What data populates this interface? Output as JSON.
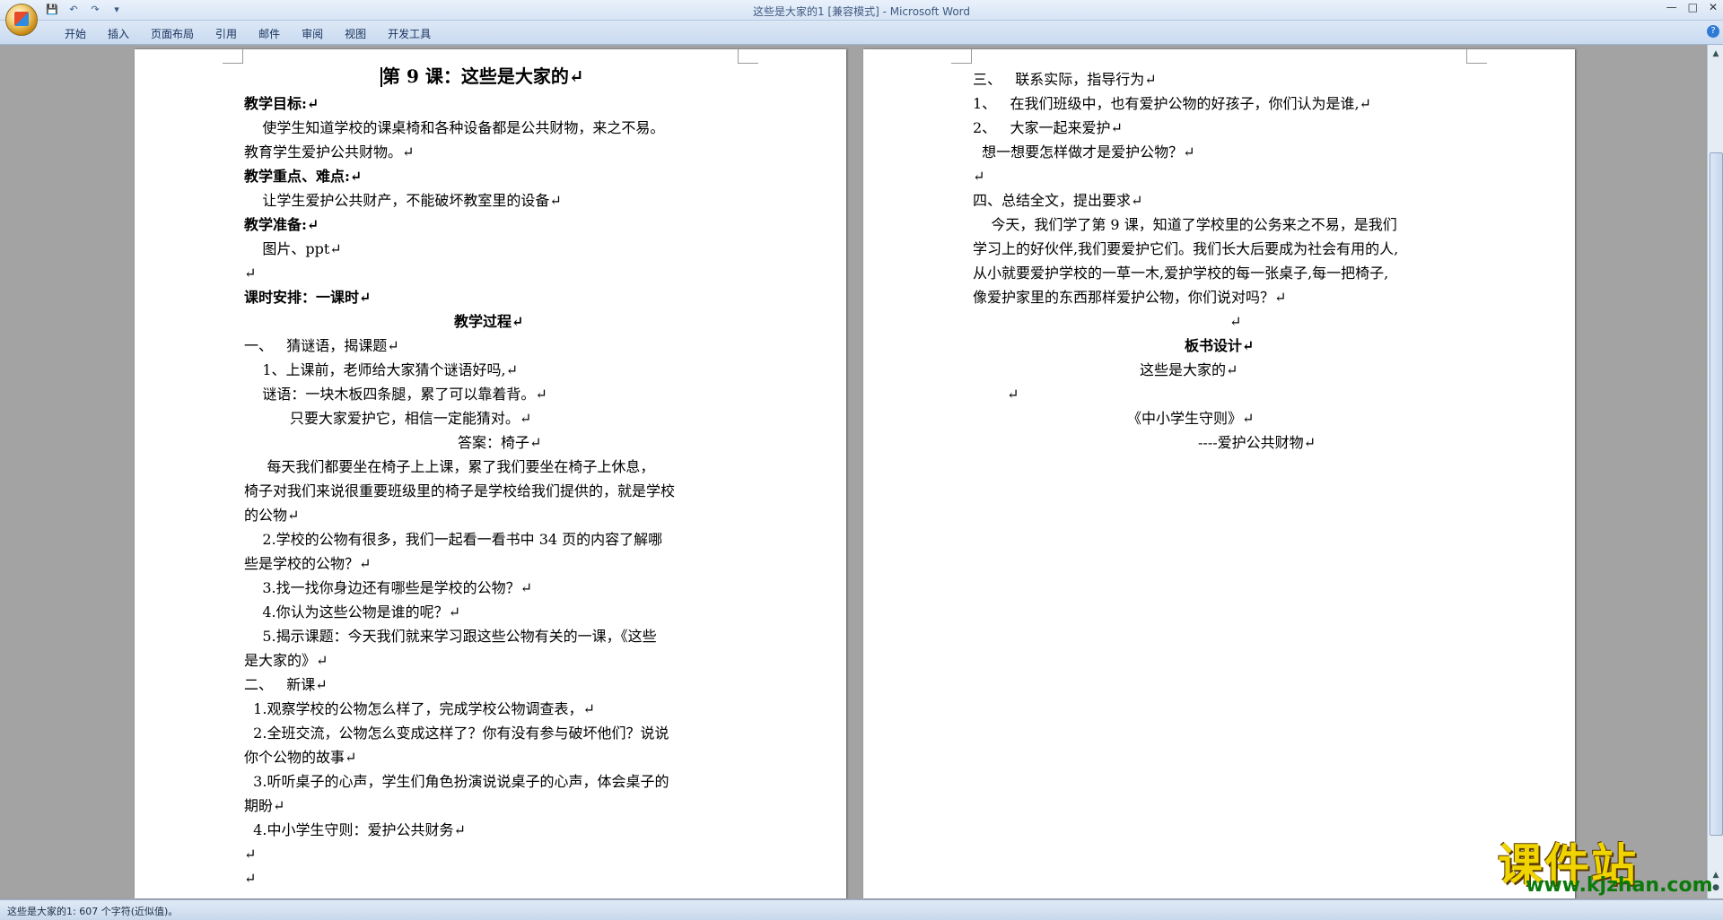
{
  "window": {
    "title": "这些是大家的1 [兼容模式] - Microsoft Word",
    "controls": [
      "—",
      "□",
      "✕"
    ]
  },
  "qat": {
    "save": "💾",
    "undo": "↶",
    "redo": "↷",
    "more": "▾"
  },
  "ribbon": {
    "tabs": [
      "开始",
      "插入",
      "页面布局",
      "引用",
      "邮件",
      "审阅",
      "视图",
      "开发工具"
    ],
    "help": "?"
  },
  "left_page": {
    "lines": [
      "第 9 课：这些是大家的↵",
      "教学目标:↵",
      "    使学生知道学校的课桌椅和各种设备都是公共财物，来之不易。",
      "教育学生爱护公共财物。↵",
      "教学重点、难点:↵",
      "    让学生爱护公共财产，不能破坏教室里的设备↵",
      "教学准备:↵",
      "    图片、ppt↵",
      "↵",
      "课时安排：一课时↵",
      "教学过程↵",
      "一、   猜谜语，揭课题↵",
      "    1、上课前，老师给大家猜个谜语好吗,↵",
      "    谜语：一块木板四条腿，累了可以靠着背。↵",
      "          只要大家爱护它，相信一定能猜对。↵",
      "答案：椅子↵",
      "     每天我们都要坐在椅子上上课，累了我们要坐在椅子上休息，",
      "椅子对我们来说很重要班级里的椅子是学校给我们提供的，就是学校",
      "的公物↵",
      "    2.学校的公物有很多，我们一起看一看书中 34 页的内容了解哪",
      "些是学校的公物？↵",
      "    3.找一找你身边还有哪些是学校的公物？↵",
      "    4.你认为这些公物是谁的呢？↵",
      "    5.揭示课题：今天我们就来学习跟这些公物有关的一课，《这些",
      "是大家的》↵",
      "二、   新课↵",
      "  1.观察学校的公物怎么样了，完成学校公物调查表，↵",
      "  2.全班交流，公物怎么变成这样了？你有没有参与破坏他们？说说",
      "你个公物的故事↵",
      "  3.听听桌子的心声，学生们角色扮演说说桌子的心声，体会桌子的",
      "期盼↵",
      "  4.中小学生守则：爱护公共财务↵",
      "↵",
      "↵"
    ]
  },
  "right_page": {
    "lines": [
      "三、   联系实际，指导行为↵",
      "1、   在我们班级中，也有爱护公物的好孩子，你们认为是谁,↵",
      "2、   大家一起来爱护↵",
      "  想一想要怎样做才是爱护公物？↵",
      "↵",
      "四、总结全文，提出要求↵",
      "    今天，我们学了第 9 课，知道了学校里的公务来之不易，是我们",
      "学习上的好伙伴,我们要爱护它们。我们长大后要成为社会有用的人,",
      "从小就要爱护学校的一草一木,爱护学校的每一张桌子,每一把椅子,",
      "像爱护家里的东西那样爱护公物，你们说对吗？↵",
      "↵",
      "板书设计↵",
      "这些是大家的↵",
      "↵",
      "《中小学生守则》↵",
      "----爱护公共财物↵"
    ]
  },
  "statusbar": {
    "text": "这些是大家的1: 607 个字符(近似值)。"
  },
  "watermark": {
    "big": "课件站",
    "small": "www.kjzhan.com"
  }
}
